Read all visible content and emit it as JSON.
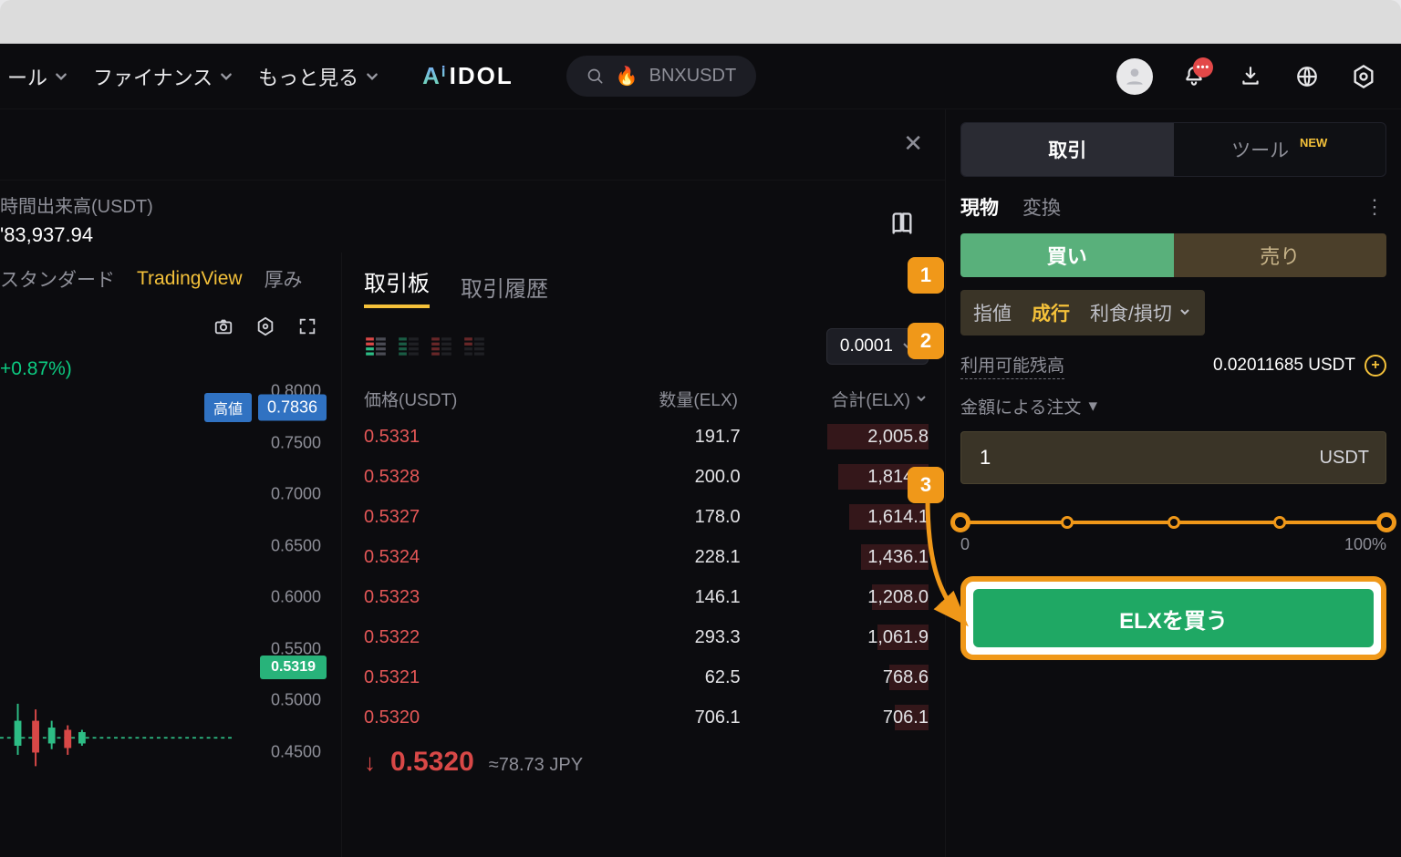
{
  "nav": {
    "items": [
      {
        "label": "ール"
      },
      {
        "label": "ファイナンス"
      },
      {
        "label": "もっと見る"
      }
    ],
    "logo": {
      "ai": "Aⁱ",
      "rest": "IDOL"
    },
    "search_text": "BNXUSDT",
    "bell_badge": "•••"
  },
  "stats": {
    "vol_label": "時間出来高(USDT)",
    "vol_value": "'83,937.94"
  },
  "chart": {
    "tabs": {
      "standard": "スタンダード",
      "tv": "TradingView",
      "depth": "厚み"
    },
    "pct": "+0.87%)",
    "y_ticks": [
      "0.8000",
      "0.7500",
      "0.7000",
      "0.6500",
      "0.6000",
      "0.5500",
      "0.5000",
      "0.4500"
    ],
    "high_label": "高値",
    "high_val": "0.7836",
    "cur": "0.5319"
  },
  "orderbook": {
    "tabs": {
      "book": "取引板",
      "history": "取引履歴"
    },
    "precision": "0.0001",
    "headers": {
      "price": "価格(USDT)",
      "qty": "数量(ELX)",
      "total": "合計(ELX)"
    },
    "rows": [
      {
        "price": "0.5331",
        "qty": "191.7",
        "total": "2,005.8",
        "depth": 18
      },
      {
        "price": "0.5328",
        "qty": "200.0",
        "total": "1,814.1",
        "depth": 16
      },
      {
        "price": "0.5327",
        "qty": "178.0",
        "total": "1,614.1",
        "depth": 14
      },
      {
        "price": "0.5324",
        "qty": "228.1",
        "total": "1,436.1",
        "depth": 12
      },
      {
        "price": "0.5323",
        "qty": "146.1",
        "total": "1,208.0",
        "depth": 10
      },
      {
        "price": "0.5322",
        "qty": "293.3",
        "total": "1,061.9",
        "depth": 9
      },
      {
        "price": "0.5321",
        "qty": "62.5",
        "total": "768.6",
        "depth": 7
      },
      {
        "price": "0.5320",
        "qty": "706.1",
        "total": "706.1",
        "depth": 6
      }
    ],
    "mid_price": "0.5320",
    "mid_fiat": "≈78.73 JPY"
  },
  "panel": {
    "tabs": {
      "trade": "取引",
      "tools": "ツール",
      "tools_new": "NEW"
    },
    "sub": {
      "spot": "現物",
      "convert": "変換"
    },
    "buy_label": "買い",
    "sell_label": "売り",
    "order_types": {
      "limit": "指値",
      "market": "成行",
      "tpsl": "利食/損切"
    },
    "bal_label": "利用可能残高",
    "bal_value": "0.02011685 USDT",
    "amt_label": "金額による注文",
    "amt_value": "1",
    "amt_unit": "USDT",
    "slider": {
      "min": "0",
      "max": "100%"
    },
    "submit": "ELXを買う"
  },
  "steps": {
    "s1": "1",
    "s2": "2",
    "s3": "3"
  }
}
